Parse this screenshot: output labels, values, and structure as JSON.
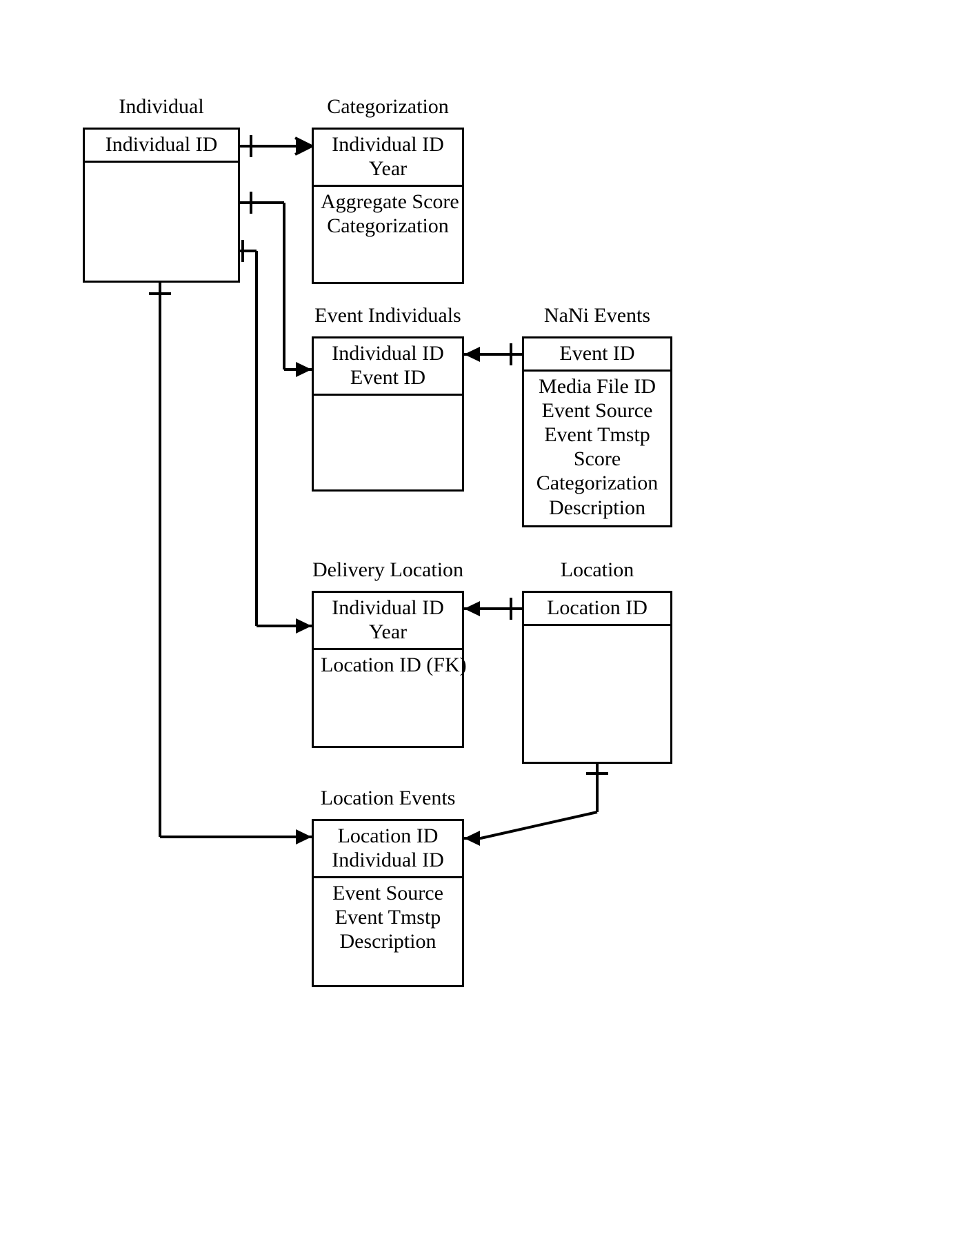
{
  "diagram": {
    "type": "entity-relationship-diagram",
    "notation": "crow's foot",
    "background_color": "#ffffff",
    "line_color": "#000000",
    "text_color": "#000000"
  },
  "entities": [
    {
      "id": "individual",
      "title": "Individual",
      "keys": [
        "Individual ID"
      ],
      "attributes": []
    },
    {
      "id": "categorization",
      "title": "Categorization",
      "keys": [
        "Individual ID",
        "Year"
      ],
      "attributes": [
        "Aggregate Score",
        "Categorization"
      ]
    },
    {
      "id": "event_individuals",
      "title": "Event Individuals",
      "keys": [
        "Individual ID",
        "Event ID"
      ],
      "attributes": []
    },
    {
      "id": "nani_events",
      "title": "NaNi Events",
      "keys": [
        "Event ID"
      ],
      "attributes": [
        "Media File ID",
        "Event Source",
        "Event Tmstp",
        "Score",
        "Categorization",
        "Description"
      ]
    },
    {
      "id": "delivery_location",
      "title": "Delivery Location",
      "keys": [
        "Individual ID",
        "Year"
      ],
      "attributes": [
        "Location ID (FK)"
      ]
    },
    {
      "id": "location",
      "title": "Location",
      "keys": [
        "Location ID"
      ],
      "attributes": []
    },
    {
      "id": "location_events",
      "title": "Location Events",
      "keys": [
        "Location ID",
        "Individual ID"
      ],
      "attributes": [
        "Event Source",
        "Event Tmstp",
        "Description"
      ]
    }
  ],
  "relationships": [
    {
      "id": "rel-individual-categorization",
      "from": "Individual",
      "to": "Categorization",
      "from_cardinality": "one",
      "to_cardinality": "many"
    },
    {
      "id": "rel-individual-event-individuals",
      "from": "Individual",
      "to": "Event Individuals",
      "from_cardinality": "one",
      "to_cardinality": "many"
    },
    {
      "id": "rel-individual-delivery-location",
      "from": "Individual",
      "to": "Delivery Location",
      "from_cardinality": "one",
      "to_cardinality": "many"
    },
    {
      "id": "rel-event-individuals-nani-events",
      "from": "Event Individuals",
      "to": "NaNi Events",
      "from_cardinality": "many",
      "to_cardinality": "one"
    },
    {
      "id": "rel-delivery-location-location",
      "from": "Delivery Location",
      "to": "Location",
      "from_cardinality": "many",
      "to_cardinality": "one"
    },
    {
      "id": "rel-individual-location-events",
      "from": "Individual",
      "to": "Location Events",
      "from_cardinality": "one",
      "to_cardinality": "many"
    },
    {
      "id": "rel-location-location-events",
      "from": "Location",
      "to": "Location Events",
      "from_cardinality": "one",
      "to_cardinality": "many"
    }
  ]
}
